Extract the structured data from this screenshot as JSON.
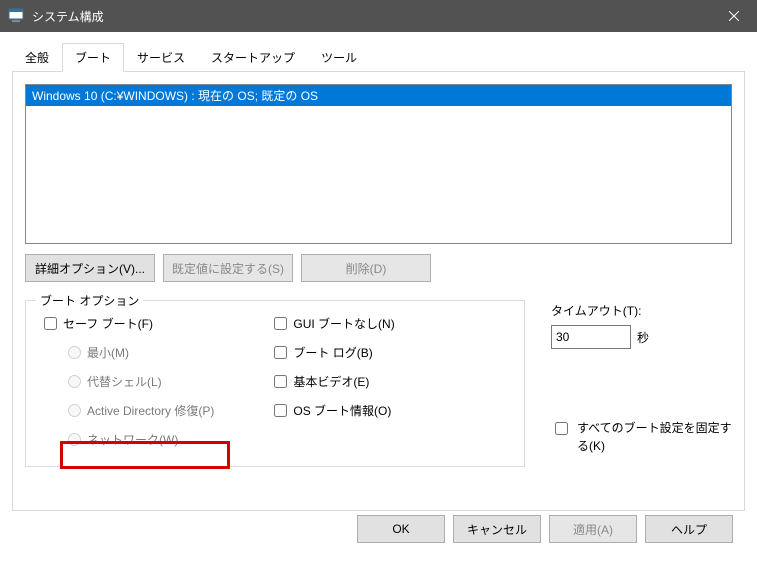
{
  "window": {
    "title": "システム構成"
  },
  "tabs": {
    "general": "全般",
    "boot": "ブート",
    "services": "サービス",
    "startup": "スタートアップ",
    "tools": "ツール"
  },
  "boot_list": {
    "entry": "Windows 10 (C:¥WINDOWS) : 現在の OS; 既定の OS"
  },
  "buttons": {
    "advanced": "詳細オプション(V)...",
    "set_default": "既定値に設定する(S)",
    "delete": "削除(D)"
  },
  "options": {
    "group_label": "ブート オプション",
    "safe_boot": "セーフ ブート(F)",
    "minimal": "最小(M)",
    "alt_shell": "代替シェル(L)",
    "ad_repair": "Active Directory 修復(P)",
    "network": "ネットワーク(W)",
    "no_gui": "GUI ブートなし(N)",
    "boot_log": "ブート ログ(B)",
    "base_video": "基本ビデオ(E)",
    "os_info": "OS ブート情報(O)"
  },
  "timeout": {
    "label": "タイムアウト(T):",
    "value": "30",
    "seconds": "秒",
    "fix_label": "すべてのブート設定を固定する(K)"
  },
  "footer": {
    "ok": "OK",
    "cancel": "キャンセル",
    "apply": "適用(A)",
    "help": "ヘルプ"
  }
}
